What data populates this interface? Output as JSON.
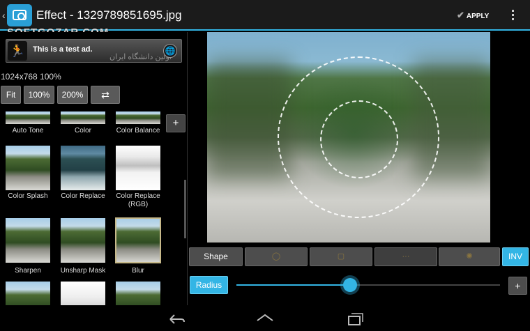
{
  "actionbar": {
    "title": "Effect - 1329789851695.jpg",
    "watermark": "SOFTGOZAR.COM",
    "apply_label": "APPLY",
    "accent": "#33b5e5"
  },
  "ad": {
    "text": "This is a test ad.",
    "persian_text": "اولین دانشگاه ایران"
  },
  "image_info": "1024x768 100%",
  "zoom_buttons": [
    "Fit",
    "100%",
    "200%",
    "⇄"
  ],
  "effects": [
    {
      "label": "Auto Tone",
      "partial": true
    },
    {
      "label": "Color",
      "partial": true
    },
    {
      "label": "Color Balance",
      "partial": true
    },
    {
      "label": "Color Splash"
    },
    {
      "label": "Color Replace"
    },
    {
      "label": "Color Replace\n(RGB)"
    },
    {
      "label": "Sharpen"
    },
    {
      "label": "Unsharp Mask"
    },
    {
      "label": "Blur",
      "selected": true
    },
    {
      "label": ""
    },
    {
      "label": ""
    },
    {
      "label": ""
    }
  ],
  "add_label": "+",
  "shape_row": {
    "shape_label": "Shape",
    "shape_options": [
      "◯",
      "▢",
      "···",
      "✺"
    ],
    "inv_label": "INV"
  },
  "radius": {
    "label": "Radius",
    "value_fraction": 0.43,
    "plus_label": "+"
  }
}
